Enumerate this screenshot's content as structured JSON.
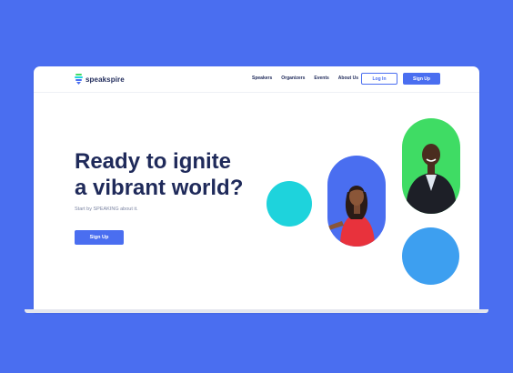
{
  "header": {
    "brand": "speakspire",
    "nav": [
      "Speakers",
      "Organizers",
      "Events",
      "About Us"
    ],
    "login_label": "Log In",
    "signup_label": "Sign Up"
  },
  "hero": {
    "headline_line1": "Ready to ignite",
    "headline_line2": "a vibrant world?",
    "subtext": "Start by SPEAKING about it.",
    "cta_label": "Sign Up"
  },
  "colors": {
    "background": "#4a6ef0",
    "primary": "#4a6ef0",
    "navy_text": "#1f2a5a",
    "teal": "#1ed3dc",
    "green": "#3fdc64",
    "sky": "#3d9ff0"
  }
}
